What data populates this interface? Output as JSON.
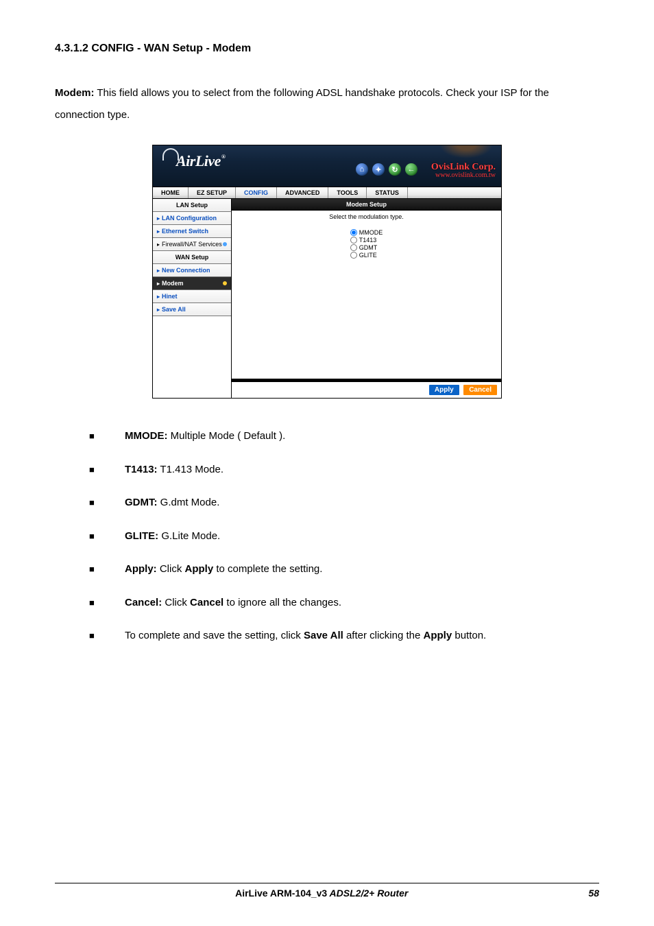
{
  "section_title": "4.3.1.2 CONFIG - WAN Setup - Modem",
  "intro_label": "Modem:",
  "intro_text": " This field allows you to select from the following ADSL handshake protocols. Check your ISP for the connection type.",
  "router": {
    "logo_text": "AirLive",
    "logo_reg": "®",
    "corp_name": "OvisLink Corp.",
    "corp_url": "www.ovislink.com.tw",
    "tabs": [
      "HOME",
      "EZ SETUP",
      "CONFIG",
      "ADVANCED",
      "TOOLS",
      "STATUS"
    ],
    "active_tab_index": 2,
    "sidebar": [
      {
        "label": "LAN Setup",
        "type": "header"
      },
      {
        "label": "LAN Configuration",
        "type": "link-blue",
        "arrow": "blue"
      },
      {
        "label": "Ethernet Switch",
        "type": "link-blue",
        "arrow": "blue"
      },
      {
        "label": "Firewall/NAT Services",
        "type": "link",
        "arrow": "black",
        "dot": "blue"
      },
      {
        "label": "WAN Setup",
        "type": "header"
      },
      {
        "label": "New Connection",
        "type": "link-blue",
        "arrow": "blue"
      },
      {
        "label": "Modem",
        "type": "dark",
        "arrow": "white",
        "dot": "yellow"
      },
      {
        "label": "Hinet",
        "type": "link-blue",
        "arrow": "blue"
      },
      {
        "label": "Save All",
        "type": "link-blue",
        "arrow": "blue"
      }
    ],
    "main_header": "Modem Setup",
    "main_sub": "Select the modulation type.",
    "options": [
      {
        "label": "MMODE",
        "checked": true
      },
      {
        "label": "T1413",
        "checked": false
      },
      {
        "label": "GDMT",
        "checked": false
      },
      {
        "label": "GLITE",
        "checked": false
      }
    ],
    "apply": "Apply",
    "cancel": "Cancel"
  },
  "bullets": [
    {
      "b": "MMODE:",
      "t": " Multiple Mode ( Default )."
    },
    {
      "b": "T1413:",
      "t": " T1.413 Mode."
    },
    {
      "b": "GDMT:",
      "t": " G.dmt Mode."
    },
    {
      "b": "GLITE:",
      "t": " G.Lite Mode."
    },
    {
      "b": "Apply:",
      "t_pre": " Click ",
      "b2": "Apply",
      "t_post": " to complete the setting."
    },
    {
      "b": "Cancel:",
      "t_pre": " Click ",
      "b2": "Cancel",
      "t_post": " to ignore all the changes."
    },
    {
      "t_pre": "To complete and save the setting, click ",
      "b2": "Save All",
      "t_mid": " after clicking the ",
      "b3": "Apply",
      "t_post": " button."
    }
  ],
  "footer": {
    "brand": "AirLive ARM-104_v3",
    "product": " ADSL2/2+ Router",
    "page": "58"
  }
}
